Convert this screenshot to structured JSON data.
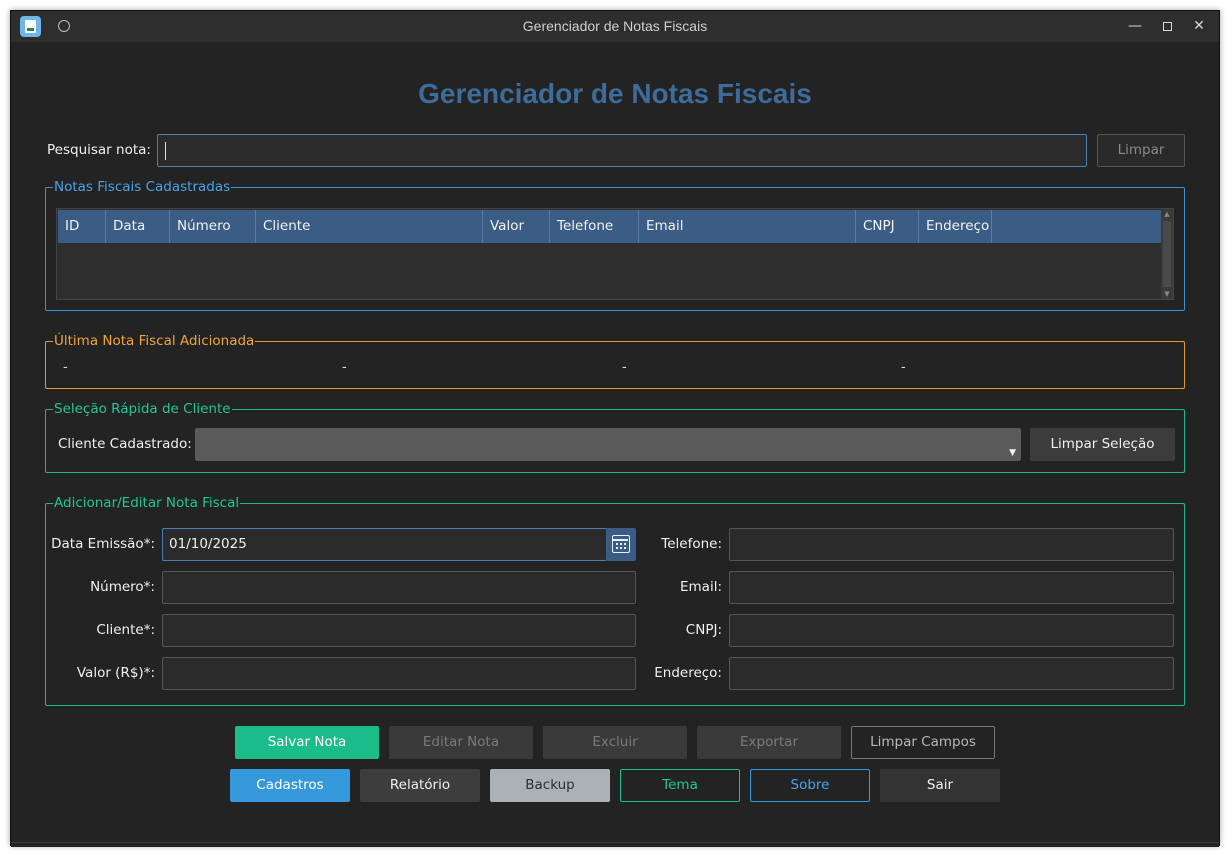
{
  "window": {
    "title": "Gerenciador de Notas Fiscais"
  },
  "header": {
    "title": "Gerenciador de Notas Fiscais"
  },
  "search": {
    "label": "Pesquisar nota:",
    "value": "",
    "clear_label": "Limpar"
  },
  "notas_group": {
    "title": "Notas Fiscais Cadastradas",
    "columns": [
      "ID",
      "Data",
      "Número",
      "Cliente",
      "Valor",
      "Telefone",
      "Email",
      "CNPJ",
      "Endereço"
    ],
    "rows": []
  },
  "ultima_group": {
    "title": "Última Nota Fiscal Adicionada",
    "values": [
      "-",
      "-",
      "-",
      "-"
    ]
  },
  "selecao_group": {
    "title": "Seleção Rápida de Cliente",
    "label": "Cliente Cadastrado:",
    "selected": "",
    "clear_label": "Limpar Seleção"
  },
  "form_group": {
    "title": "Adicionar/Editar Nota Fiscal",
    "data_emissao": {
      "label": "Data Emissão*:",
      "value": "01/10/2025"
    },
    "numero": {
      "label": "Número*:",
      "value": ""
    },
    "cliente": {
      "label": "Cliente*:",
      "value": ""
    },
    "valor": {
      "label": "Valor (R$)*:",
      "value": ""
    },
    "telefone": {
      "label": "Telefone:",
      "value": ""
    },
    "email": {
      "label": "Email:",
      "value": ""
    },
    "cnpj": {
      "label": "CNPJ:",
      "value": ""
    },
    "endereco": {
      "label": "Endereço:",
      "value": ""
    }
  },
  "actions": {
    "salvar": "Salvar Nota",
    "editar": "Editar Nota",
    "excluir": "Excluir",
    "exportar": "Exportar",
    "limpar_campos": "Limpar Campos",
    "cadastros": "Cadastros",
    "relatorio": "Relatório",
    "backup": "Backup",
    "tema": "Tema",
    "sobre": "Sobre",
    "sair": "Sair"
  },
  "icons": {
    "app": "invoice-app-icon",
    "calendar": "calendar-icon",
    "dropdown": "chevron-down-icon"
  },
  "colors": {
    "accent_blue": "#3498db",
    "accent_green": "#1abc8a",
    "accent_orange": "#e29a2e",
    "header_blue": "#3d6c9b",
    "background": "#232323"
  }
}
